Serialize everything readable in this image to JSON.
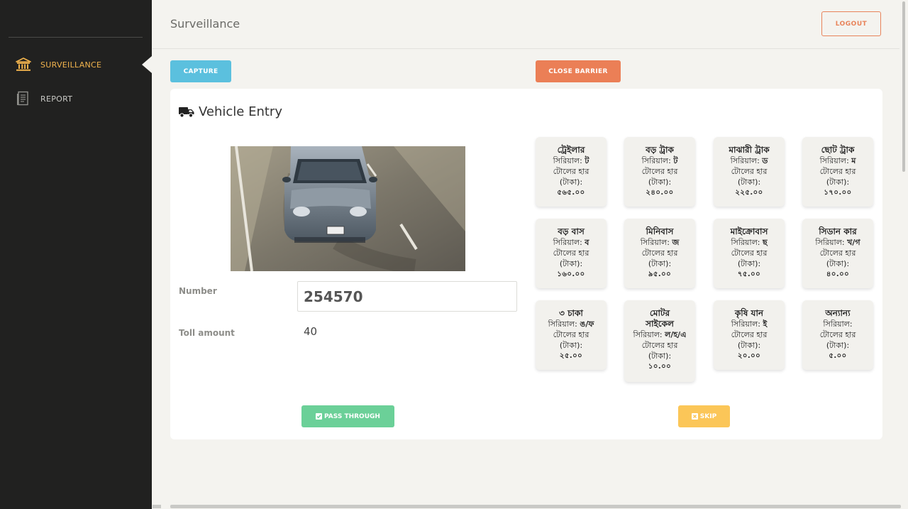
{
  "sidebar": {
    "items": [
      {
        "label": "SURVEILLANCE",
        "icon": "bank-icon",
        "active": true
      },
      {
        "label": "REPORT",
        "icon": "document-icon",
        "active": false
      }
    ]
  },
  "header": {
    "title": "Surveillance",
    "logout_label": "LOGOUT"
  },
  "toolbar": {
    "capture_label": "CAPTURE",
    "close_barrier_label": "CLOSE BARRIER"
  },
  "entry": {
    "title": "Vehicle Entry",
    "number_label": "Number",
    "number_value": "254570",
    "toll_label": "Toll amount",
    "toll_value": "40",
    "pass_label": "PASS THROUGH",
    "skip_label": "SKIP"
  },
  "vehicle_types": [
    {
      "name": "ট্রেইলার",
      "serial_prefix": "সিরিয়াল:",
      "serial": "ট",
      "rate_label": "টোলের হার",
      "unit": "(টাকা):",
      "amount": "৫৬৫.০০"
    },
    {
      "name": "বড় ট্রাক",
      "serial_prefix": "সিরিয়াল:",
      "serial": "ট",
      "rate_label": "টোলের হার",
      "unit": "(টাকা):",
      "amount": "২৪০.০০"
    },
    {
      "name": "মাঝারী ট্রাক",
      "serial_prefix": "সিরিয়াল:",
      "serial": "ড",
      "rate_label": "টোলের হার",
      "unit": "(টাকা):",
      "amount": "২২৫.০০"
    },
    {
      "name": "ছোট ট্রাক",
      "serial_prefix": "সিরিয়াল:",
      "serial": "ম",
      "rate_label": "টোলের হার",
      "unit": "(টাকা):",
      "amount": "১৭০.০০"
    },
    {
      "name": "বড় বাস",
      "serial_prefix": "সিরিয়াল:",
      "serial": "ব",
      "rate_label": "টোলের হার",
      "unit": "(টাকা):",
      "amount": "১৬০.০০"
    },
    {
      "name": "মিনিবাস",
      "serial_prefix": "সিরিয়াল:",
      "serial": "জ",
      "rate_label": "টোলের হার",
      "unit": "(টাকা):",
      "amount": "৯৫.০০"
    },
    {
      "name": "মাইক্রোবাস",
      "serial_prefix": "সিরিয়াল:",
      "serial": "ছ",
      "rate_label": "টোলের হার",
      "unit": "(টাকা):",
      "amount": "৭৫.০০"
    },
    {
      "name": "সিডান কার",
      "serial_prefix": "সিরিয়াল:",
      "serial": "খ/গ",
      "rate_label": "টোলের হার",
      "unit": "(টাকা):",
      "amount": "৪০.০০"
    },
    {
      "name": "৩ চাকা",
      "serial_prefix": "সিরিয়াল:",
      "serial": "ঙ/ফ",
      "rate_label": "টোলের হার",
      "unit": "(টাকা):",
      "amount": "২৫.০০"
    },
    {
      "name": "মোটর সাইকেল",
      "serial_prefix": "সিরিয়াল:",
      "serial": "ল/হ/এ",
      "rate_label": "টোলের হার",
      "unit": "(টাকা):",
      "amount": "১০.০০"
    },
    {
      "name": "কৃষি যান",
      "serial_prefix": "সিরিয়াল:",
      "serial": "ই",
      "rate_label": "টোলের হার",
      "unit": "(টাকা):",
      "amount": "২০.০০"
    },
    {
      "name": "অন্যান্য",
      "serial_prefix": "সিরিয়াল:",
      "serial": "",
      "rate_label": "টোলের হার",
      "unit": "(টাকা):",
      "amount": "৫.০০"
    }
  ],
  "colors": {
    "sidebar_bg": "#212120",
    "accent_active": "#f2b44d",
    "capture": "#5bc0de",
    "close_barrier": "#eb7f56",
    "pass": "#6bd098",
    "skip": "#fbc658"
  }
}
